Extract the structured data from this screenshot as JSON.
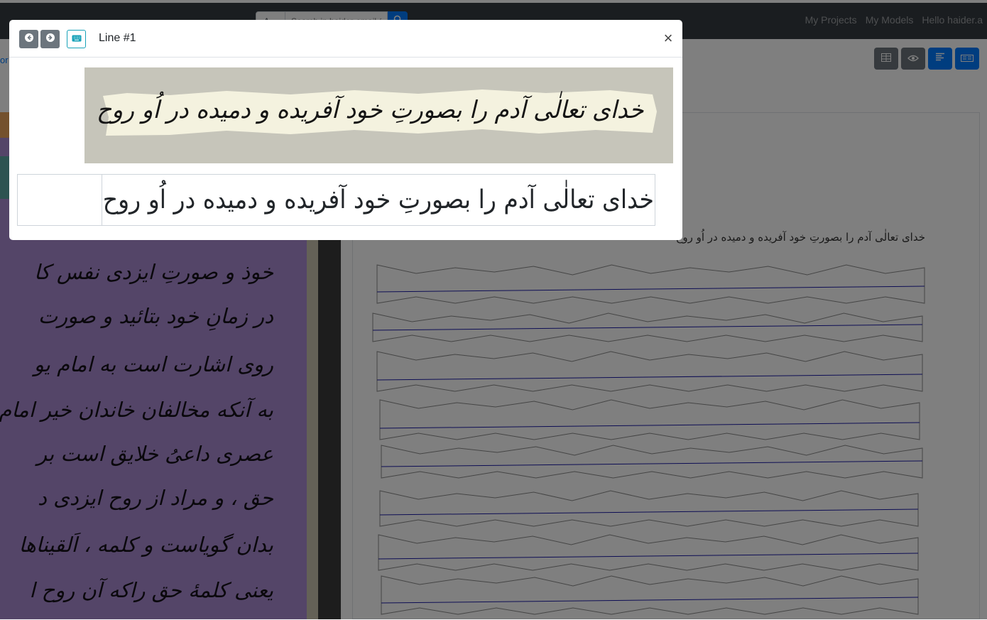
{
  "navbar": {
    "select_value": "A",
    "search_placeholder": "Search in haider-email-19",
    "links": [
      "My Projects",
      "My Models",
      "Hello haider.a"
    ]
  },
  "subbar": {
    "link_fragment": "or"
  },
  "background_manuscript": {
    "lines": [
      "خوذ و صورتِ ایزدی نفس کا",
      "در زمانِ خود بتائید و صورت",
      "روی اشارت است به امام یو",
      "به آنکه مخالفان خاندان خیر امام",
      "عصری داعیُ خلایق است بر",
      "حق ، و مراد از روح ایزدی د",
      "بدان گویاست و کلمه ، اَلقیناها",
      "یعنی کلمهٔ حق راکه آن روح ا"
    ]
  },
  "segmentation_panel": {
    "transcript_line": "خدای تعالٰی آدم را بصورتِ خود آفریده و دمیده در اُو روح"
  },
  "modal": {
    "title": "Line #1",
    "close_symbol": "×",
    "line_image_text": "خدای تعالٰی آدم را بصورتِ خود آفریده و دمیده در اُو روح",
    "transcription": "خدای تعالٰی آدم را بصورتِ خود آفریده و دمیده در اُو روح"
  },
  "colors": {
    "navbar_bg": "#343a40",
    "primary": "#007bff",
    "secondary": "#6c757d",
    "info": "#17a2b8",
    "baseline": "#1a1aa8"
  },
  "icons": [
    "search-icon",
    "table-icon",
    "eye-icon",
    "align-left-icon",
    "text-block-icon",
    "arrow-left-circle-icon",
    "arrow-right-circle-icon",
    "keyboard-icon"
  ]
}
